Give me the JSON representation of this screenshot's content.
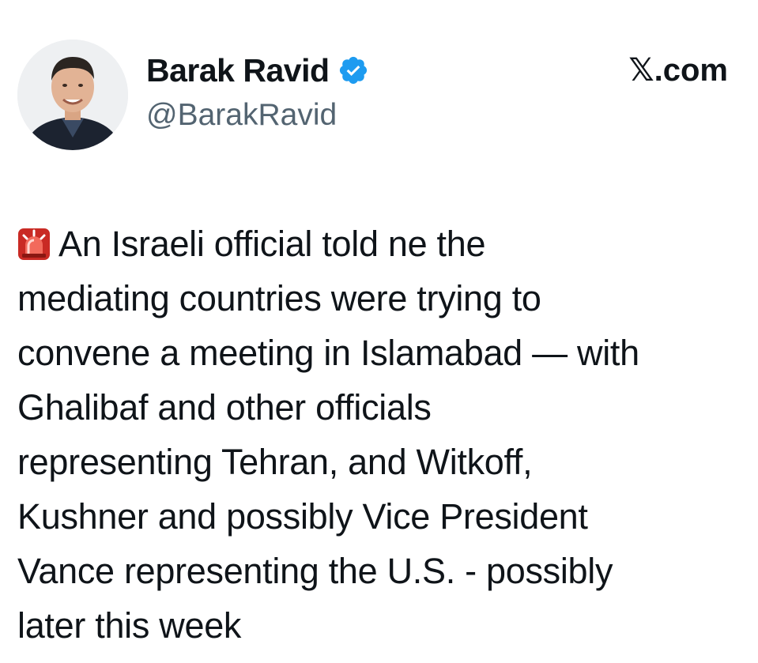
{
  "author": {
    "display_name": "Barak Ravid",
    "handle": "@BarakRavid",
    "verified_icon": "verified-badge-icon",
    "avatar_icon": "profile-photo"
  },
  "brand": {
    "label": "X.com",
    "x_glyph": "𝕏",
    "suffix": ".com"
  },
  "tweet": {
    "emoji_icon": "police-siren-icon",
    "lines": [
      "An Israeli official told ne the",
      "mediating countries were trying to",
      "convene a meeting in Islamabad — with",
      "Ghalibaf and other officials",
      "representing Tehran, and Witkoff,",
      "Kushner and possibly Vice President",
      "Vance representing the U.S. - possibly",
      "later this week"
    ]
  },
  "colors": {
    "text_primary": "#0f1419",
    "text_secondary": "#536471",
    "verified_blue": "#1d9bf0",
    "background": "#ffffff",
    "siren_red": "#e0312b"
  }
}
